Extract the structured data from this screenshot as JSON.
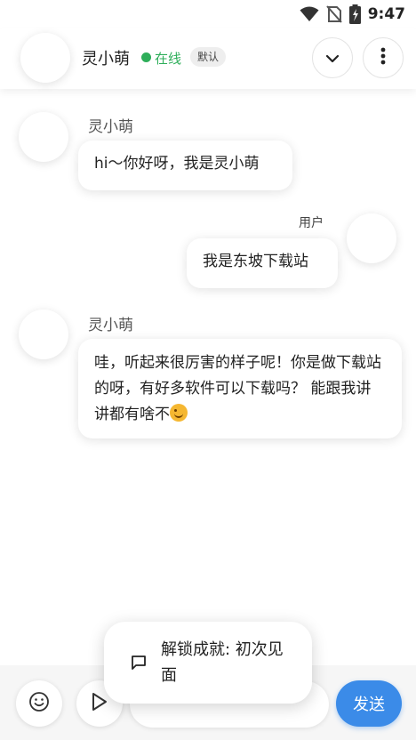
{
  "status_bar": {
    "time": "9:47",
    "icons": [
      "wifi-icon",
      "no-sim-icon",
      "battery-charging-icon"
    ]
  },
  "header": {
    "name": "灵小萌",
    "status": "在线",
    "status_color": "#2eae5a",
    "mode_badge": "默认",
    "icons": [
      "chevron-down-icon",
      "more-vertical-icon"
    ]
  },
  "messages": [
    {
      "sender": "灵小萌",
      "side": "left",
      "text": "hi～你好呀，我是灵小萌"
    },
    {
      "sender": "用户",
      "side": "right",
      "text": "我是东坡下载站"
    },
    {
      "sender": "灵小萌",
      "side": "left",
      "text": "哇，听起来很厉害的样子呢！你是做下载站的呀，有好多软件可以下载吗？ 能跟我讲讲都有啥不",
      "trailing_emoji": "smirk-emoji-icon"
    }
  ],
  "toast": {
    "text": "解锁成就: 初次见面",
    "icon": "message-icon"
  },
  "input_bar": {
    "input_value": "",
    "send_label": "发送",
    "accent": "#3b8be8",
    "icons": [
      "emoji-icon",
      "play-icon"
    ]
  }
}
